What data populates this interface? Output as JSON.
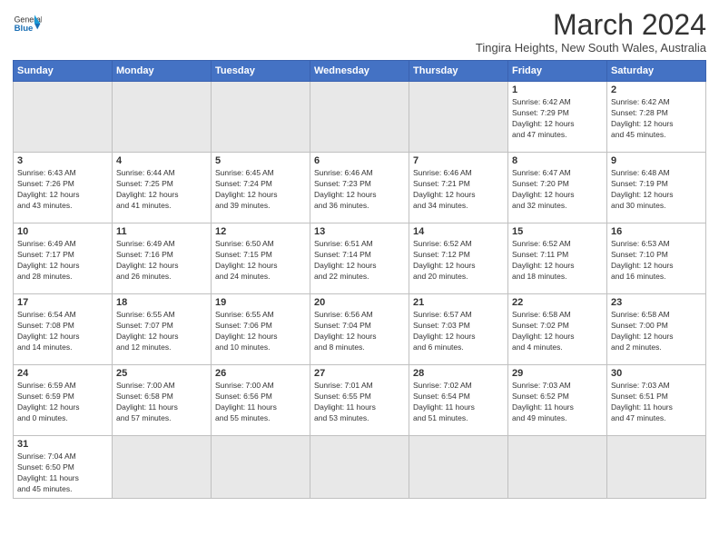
{
  "logo": {
    "general": "General",
    "blue": "Blue"
  },
  "title": "March 2024",
  "location": "Tingira Heights, New South Wales, Australia",
  "days_header": [
    "Sunday",
    "Monday",
    "Tuesday",
    "Wednesday",
    "Thursday",
    "Friday",
    "Saturday"
  ],
  "weeks": [
    [
      {
        "day": "",
        "info": ""
      },
      {
        "day": "",
        "info": ""
      },
      {
        "day": "",
        "info": ""
      },
      {
        "day": "",
        "info": ""
      },
      {
        "day": "",
        "info": ""
      },
      {
        "day": "1",
        "info": "Sunrise: 6:42 AM\nSunset: 7:29 PM\nDaylight: 12 hours\nand 47 minutes."
      },
      {
        "day": "2",
        "info": "Sunrise: 6:42 AM\nSunset: 7:28 PM\nDaylight: 12 hours\nand 45 minutes."
      }
    ],
    [
      {
        "day": "3",
        "info": "Sunrise: 6:43 AM\nSunset: 7:26 PM\nDaylight: 12 hours\nand 43 minutes."
      },
      {
        "day": "4",
        "info": "Sunrise: 6:44 AM\nSunset: 7:25 PM\nDaylight: 12 hours\nand 41 minutes."
      },
      {
        "day": "5",
        "info": "Sunrise: 6:45 AM\nSunset: 7:24 PM\nDaylight: 12 hours\nand 39 minutes."
      },
      {
        "day": "6",
        "info": "Sunrise: 6:46 AM\nSunset: 7:23 PM\nDaylight: 12 hours\nand 36 minutes."
      },
      {
        "day": "7",
        "info": "Sunrise: 6:46 AM\nSunset: 7:21 PM\nDaylight: 12 hours\nand 34 minutes."
      },
      {
        "day": "8",
        "info": "Sunrise: 6:47 AM\nSunset: 7:20 PM\nDaylight: 12 hours\nand 32 minutes."
      },
      {
        "day": "9",
        "info": "Sunrise: 6:48 AM\nSunset: 7:19 PM\nDaylight: 12 hours\nand 30 minutes."
      }
    ],
    [
      {
        "day": "10",
        "info": "Sunrise: 6:49 AM\nSunset: 7:17 PM\nDaylight: 12 hours\nand 28 minutes."
      },
      {
        "day": "11",
        "info": "Sunrise: 6:49 AM\nSunset: 7:16 PM\nDaylight: 12 hours\nand 26 minutes."
      },
      {
        "day": "12",
        "info": "Sunrise: 6:50 AM\nSunset: 7:15 PM\nDaylight: 12 hours\nand 24 minutes."
      },
      {
        "day": "13",
        "info": "Sunrise: 6:51 AM\nSunset: 7:14 PM\nDaylight: 12 hours\nand 22 minutes."
      },
      {
        "day": "14",
        "info": "Sunrise: 6:52 AM\nSunset: 7:12 PM\nDaylight: 12 hours\nand 20 minutes."
      },
      {
        "day": "15",
        "info": "Sunrise: 6:52 AM\nSunset: 7:11 PM\nDaylight: 12 hours\nand 18 minutes."
      },
      {
        "day": "16",
        "info": "Sunrise: 6:53 AM\nSunset: 7:10 PM\nDaylight: 12 hours\nand 16 minutes."
      }
    ],
    [
      {
        "day": "17",
        "info": "Sunrise: 6:54 AM\nSunset: 7:08 PM\nDaylight: 12 hours\nand 14 minutes."
      },
      {
        "day": "18",
        "info": "Sunrise: 6:55 AM\nSunset: 7:07 PM\nDaylight: 12 hours\nand 12 minutes."
      },
      {
        "day": "19",
        "info": "Sunrise: 6:55 AM\nSunset: 7:06 PM\nDaylight: 12 hours\nand 10 minutes."
      },
      {
        "day": "20",
        "info": "Sunrise: 6:56 AM\nSunset: 7:04 PM\nDaylight: 12 hours\nand 8 minutes."
      },
      {
        "day": "21",
        "info": "Sunrise: 6:57 AM\nSunset: 7:03 PM\nDaylight: 12 hours\nand 6 minutes."
      },
      {
        "day": "22",
        "info": "Sunrise: 6:58 AM\nSunset: 7:02 PM\nDaylight: 12 hours\nand 4 minutes."
      },
      {
        "day": "23",
        "info": "Sunrise: 6:58 AM\nSunset: 7:00 PM\nDaylight: 12 hours\nand 2 minutes."
      }
    ],
    [
      {
        "day": "24",
        "info": "Sunrise: 6:59 AM\nSunset: 6:59 PM\nDaylight: 12 hours\nand 0 minutes."
      },
      {
        "day": "25",
        "info": "Sunrise: 7:00 AM\nSunset: 6:58 PM\nDaylight: 11 hours\nand 57 minutes."
      },
      {
        "day": "26",
        "info": "Sunrise: 7:00 AM\nSunset: 6:56 PM\nDaylight: 11 hours\nand 55 minutes."
      },
      {
        "day": "27",
        "info": "Sunrise: 7:01 AM\nSunset: 6:55 PM\nDaylight: 11 hours\nand 53 minutes."
      },
      {
        "day": "28",
        "info": "Sunrise: 7:02 AM\nSunset: 6:54 PM\nDaylight: 11 hours\nand 51 minutes."
      },
      {
        "day": "29",
        "info": "Sunrise: 7:03 AM\nSunset: 6:52 PM\nDaylight: 11 hours\nand 49 minutes."
      },
      {
        "day": "30",
        "info": "Sunrise: 7:03 AM\nSunset: 6:51 PM\nDaylight: 11 hours\nand 47 minutes."
      }
    ],
    [
      {
        "day": "31",
        "info": "Sunrise: 7:04 AM\nSunset: 6:50 PM\nDaylight: 11 hours\nand 45 minutes."
      },
      {
        "day": "",
        "info": ""
      },
      {
        "day": "",
        "info": ""
      },
      {
        "day": "",
        "info": ""
      },
      {
        "day": "",
        "info": ""
      },
      {
        "day": "",
        "info": ""
      },
      {
        "day": "",
        "info": ""
      }
    ]
  ]
}
